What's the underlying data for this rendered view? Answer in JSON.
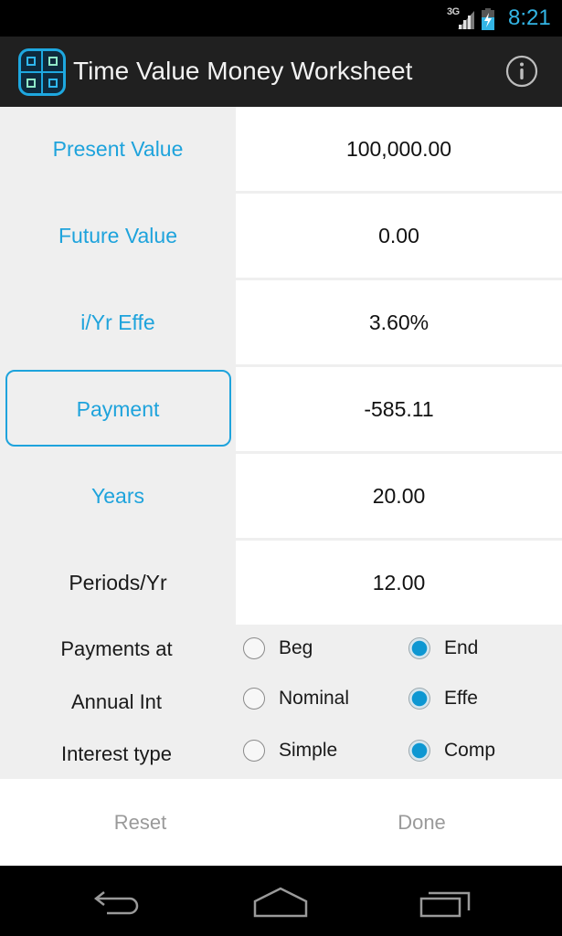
{
  "status_bar": {
    "network": "3G",
    "time": "8:21",
    "icons": [
      "signal-icon",
      "battery-charging-icon"
    ]
  },
  "action_bar": {
    "title": "Time Value Money Worksheet",
    "app_icon": "calculator-grid-icon",
    "info_icon": "info-icon"
  },
  "fields": [
    {
      "label": "Present Value",
      "value": "100,000.00",
      "style": "link"
    },
    {
      "label": "Future Value",
      "value": "0.00",
      "style": "link"
    },
    {
      "label": "i/Yr Effe",
      "value": "3.60%",
      "style": "link"
    },
    {
      "label": "Payment",
      "value": "-585.11",
      "style": "link",
      "focused": true
    },
    {
      "label": "Years",
      "value": "20.00",
      "style": "link"
    },
    {
      "label": "Periods/Yr",
      "value": "12.00",
      "style": "plain"
    }
  ],
  "options": [
    {
      "label": "Payments at",
      "choices": [
        "Beg",
        "End"
      ],
      "selected": 1
    },
    {
      "label": "Annual Int",
      "choices": [
        "Nominal",
        "Effe"
      ],
      "selected": 1
    },
    {
      "label": "Interest type",
      "choices": [
        "Simple",
        "Comp"
      ],
      "selected": 1
    }
  ],
  "buttons": {
    "reset": "Reset",
    "done": "Done"
  },
  "nav_bar": {
    "icons": [
      "back-icon",
      "home-icon",
      "recent-apps-icon"
    ]
  },
  "colors": {
    "accent": "#1ea3dc",
    "clock": "#33b5e5",
    "radio_fill": "#0d97d2"
  }
}
